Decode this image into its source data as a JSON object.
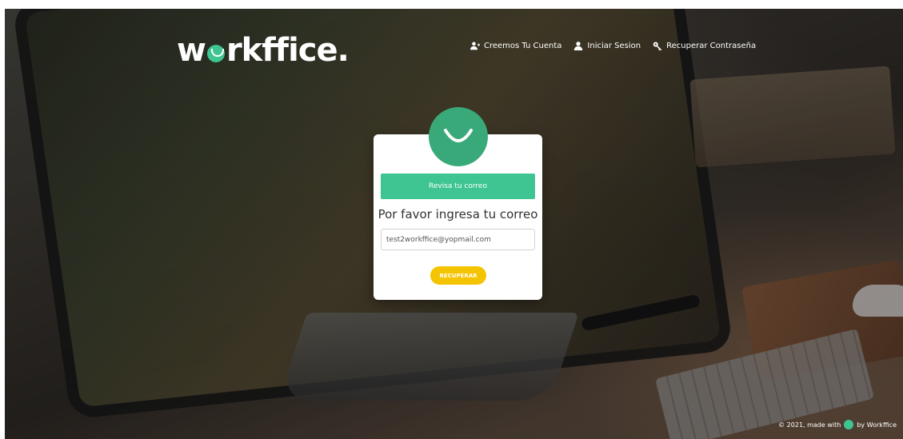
{
  "brand": {
    "logo_prefix": "w",
    "logo_suffix": "rkffice.",
    "accent_color": "#3ec591",
    "button_color": "#f5c400"
  },
  "nav": {
    "items": [
      {
        "label": "Creemos Tu Cuenta",
        "icon": "user-plus-icon"
      },
      {
        "label": "Iniciar Sesion",
        "icon": "user-icon"
      },
      {
        "label": "Recuperar Contraseña",
        "icon": "key-icon"
      }
    ]
  },
  "card": {
    "avatar_icon": "smile-icon",
    "alert_text": "Revisa tu correo",
    "heading": "Por favor ingresa tu correo",
    "email_value": "test2workffice@yopmail.com",
    "submit_label": "RECUPERAR"
  },
  "footer": {
    "prefix": "© 2021, made with",
    "suffix": "by Workffice"
  }
}
